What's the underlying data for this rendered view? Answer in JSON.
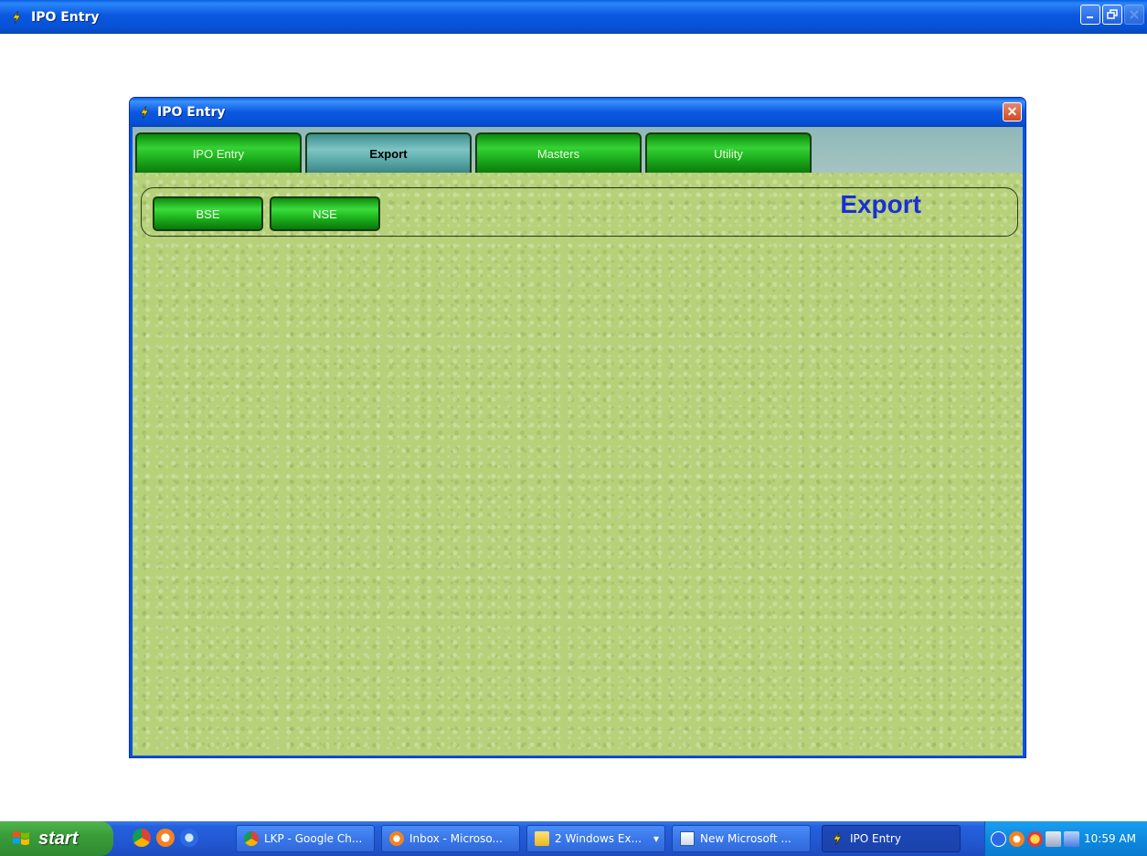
{
  "app": {
    "title": "IPO Entry",
    "title_icon": "lightning-icon",
    "window_controls": [
      "minimize",
      "restore",
      "close"
    ]
  },
  "dialog": {
    "title": "IPO Entry",
    "close_label": "✕",
    "tabs": [
      {
        "label": "IPO Entry",
        "active": false
      },
      {
        "label": "Export",
        "active": true
      },
      {
        "label": "Masters",
        "active": false
      },
      {
        "label": "Utility",
        "active": false
      }
    ],
    "panel": {
      "heading": "Export",
      "buttons": [
        {
          "label": "BSE"
        },
        {
          "label": "NSE"
        }
      ]
    }
  },
  "taskbar": {
    "start_label": "start",
    "quick_launch": [
      "chrome-icon",
      "outlook-icon",
      "browser-icon"
    ],
    "tasks": [
      {
        "label": "LKP - Google Ch...",
        "icon": "chrome-icon",
        "active": false
      },
      {
        "label": "Inbox - Microso...",
        "icon": "outlook-icon",
        "active": false
      },
      {
        "label": "2 Windows Ex...",
        "icon": "folder-icon",
        "active": false
      },
      {
        "label": "New Microsoft ...",
        "icon": "word-icon",
        "active": false
      },
      {
        "label": "IPO Entry",
        "icon": "lightning-icon",
        "active": true
      }
    ],
    "tray_icons": [
      "arrow-icon",
      "outlook-icon",
      "messenger-icon",
      "network-icon",
      "display-icon"
    ],
    "clock": "10:59 AM"
  },
  "colors": {
    "xp_blue": "#0054e3",
    "panel_green": "#b7d17a",
    "button_green": "#1fb81f",
    "active_tab_teal": "#5aa8a8",
    "heading_blue": "#1a2fd6"
  }
}
